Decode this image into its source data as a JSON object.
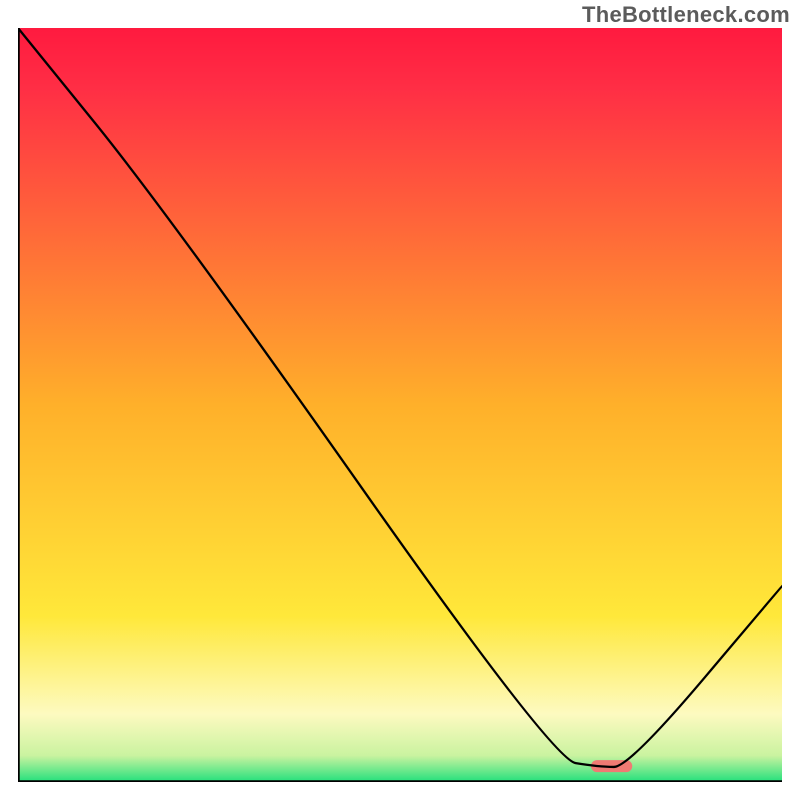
{
  "watermark": "TheBottleneck.com",
  "chart_data": {
    "type": "line",
    "title": "",
    "xlabel": "",
    "ylabel": "",
    "xlim": [
      0,
      100
    ],
    "ylim": [
      0,
      100
    ],
    "series": [
      {
        "name": "bottleneck-curve",
        "x": [
          0,
          20,
          70,
          76,
          80,
          100
        ],
        "values": [
          100,
          75,
          3,
          2,
          2,
          26
        ]
      }
    ],
    "marker": {
      "x": [
        75.0,
        80.4
      ],
      "y": 2.1,
      "color": "#ef7a73"
    },
    "background_gradient": {
      "stops": [
        {
          "pos": 0,
          "color": "#ff1a3f"
        },
        {
          "pos": 0.08,
          "color": "#ff2e45"
        },
        {
          "pos": 0.5,
          "color": "#ffb02a"
        },
        {
          "pos": 0.78,
          "color": "#ffe83a"
        },
        {
          "pos": 0.91,
          "color": "#fdfac0"
        },
        {
          "pos": 0.965,
          "color": "#caf3a0"
        },
        {
          "pos": 1.0,
          "color": "#22e07c"
        }
      ]
    },
    "axis_color": "#000000",
    "line_color": "#000000",
    "line_width": 2.3
  }
}
